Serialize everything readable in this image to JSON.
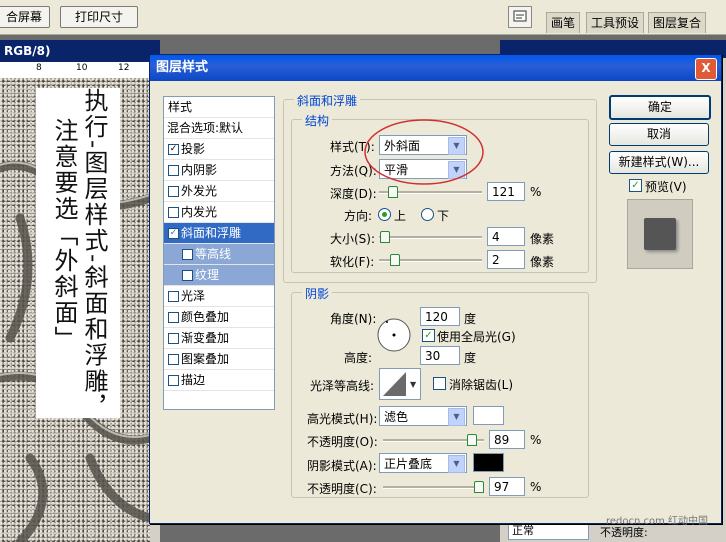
{
  "toolbar": {
    "fit_screen": "合屏幕",
    "print_size": "打印尺寸",
    "tabs": [
      "画笔",
      "工具预设",
      "图层复合"
    ]
  },
  "document": {
    "title": "RGB/8)",
    "ruler_marks": [
      "8",
      "10",
      "12"
    ],
    "annotation_col1": "执行-图层样式-斜面和浮雕，",
    "annotation_col2": "注意要选「外斜面」"
  },
  "dialog": {
    "title": "图层样式",
    "close": "X",
    "style_list": {
      "header": "样式",
      "items": [
        {
          "label": "混合选项:默认",
          "checkbox": false,
          "checked": false
        },
        {
          "label": "投影",
          "checkbox": true,
          "checked": true
        },
        {
          "label": "内阴影",
          "checkbox": true,
          "checked": false
        },
        {
          "label": "外发光",
          "checkbox": true,
          "checked": false
        },
        {
          "label": "内发光",
          "checkbox": true,
          "checked": false
        },
        {
          "label": "斜面和浮雕",
          "checkbox": true,
          "checked": true,
          "selected": true
        },
        {
          "label": "等高线",
          "checkbox": true,
          "checked": false,
          "sub": true
        },
        {
          "label": "纹理",
          "checkbox": true,
          "checked": false,
          "sub": true
        },
        {
          "label": "光泽",
          "checkbox": true,
          "checked": false
        },
        {
          "label": "颜色叠加",
          "checkbox": true,
          "checked": false
        },
        {
          "label": "渐变叠加",
          "checkbox": true,
          "checked": false
        },
        {
          "label": "图案叠加",
          "checkbox": true,
          "checked": false
        },
        {
          "label": "描边",
          "checkbox": true,
          "checked": false
        }
      ]
    },
    "bevel": {
      "group_title": "斜面和浮雕",
      "structure_title": "结构",
      "style_label": "样式(T):",
      "style_value": "外斜面",
      "technique_label": "方法(Q):",
      "technique_value": "平滑",
      "depth_label": "深度(D):",
      "depth_value": "121",
      "depth_unit": "%",
      "direction_label": "方向:",
      "direction_up": "上",
      "direction_down": "下",
      "size_label": "大小(S):",
      "size_value": "4",
      "size_unit": "像素",
      "soften_label": "软化(F):",
      "soften_value": "2",
      "soften_unit": "像素"
    },
    "shading": {
      "title": "阴影",
      "angle_label": "角度(N):",
      "angle_value": "120",
      "angle_unit": "度",
      "global_light_label": "使用全局光(G)",
      "altitude_label": "高度:",
      "altitude_value": "30",
      "altitude_unit": "度",
      "gloss_label": "光泽等高线:",
      "antialias_label": "消除锯齿(L)",
      "highlight_mode_label": "高光模式(H):",
      "highlight_mode_value": "滤色",
      "highlight_color": "#ffffff",
      "highlight_opacity_label": "不透明度(O):",
      "highlight_opacity_value": "89",
      "shadow_mode_label": "阴影模式(A):",
      "shadow_mode_value": "正片叠底",
      "shadow_color": "#000000",
      "shadow_opacity_label": "不透明度(C):",
      "shadow_opacity_value": "97",
      "percent": "%"
    },
    "buttons": {
      "ok": "确定",
      "cancel": "取消",
      "new_style": "新建样式(W)...",
      "preview": "预览(V)"
    }
  },
  "right_panel": {
    "blend_mode": "正常",
    "opacity_label": "不透明度:"
  },
  "watermark": "redocn.com 红动中国"
}
